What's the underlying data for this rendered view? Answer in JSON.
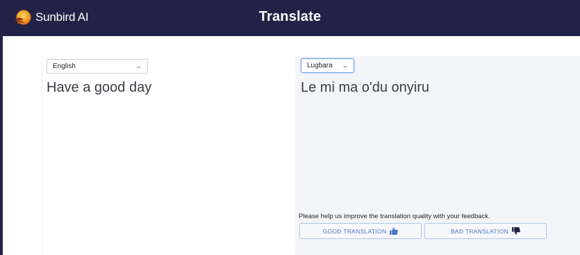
{
  "header": {
    "brand_name": "Sunbird AI",
    "page_title": "Translate"
  },
  "source": {
    "language": "English",
    "text": "Have a good day"
  },
  "target": {
    "language": "Lugbara",
    "text": "Le mi ma o'du onyiru"
  },
  "feedback": {
    "prompt": "Please help us improve the translation quality with your feedback.",
    "good_label": "GOOD TRANSLATION",
    "bad_label": "BAD TRANSLATION"
  },
  "icons": {
    "brand": "sunbird-logo-icon",
    "select_arrow": "chevron-down-icon",
    "good": "thumbs-up-icon",
    "bad": "thumbs-down-icon"
  },
  "colors": {
    "header_bg": "#232246",
    "accent": "#4a78c2",
    "logo_orange": "#f0a227"
  }
}
